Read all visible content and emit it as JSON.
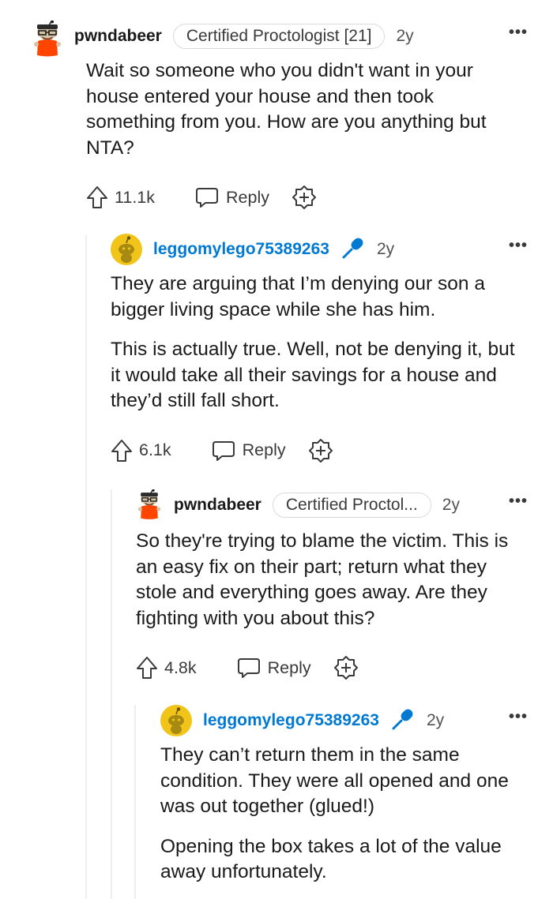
{
  "comments": [
    {
      "username": "pwndabeer",
      "flair": "Certified Proctologist [21]",
      "age": "2y",
      "more": "•••",
      "body": [
        "Wait so someone who you didn't want in your house entered your house and then took something from you. How are you anything but NTA?"
      ],
      "votes": "11.1k",
      "reply_label": "Reply"
    },
    {
      "username": "leggomylego75389263",
      "age": "2y",
      "more": "•••",
      "body": [
        "They are arguing that I’m denying our son a bigger living space while she has him.",
        "This is actually true. Well, not be denying it, but it would take all their savings for a house and they’d still fall short."
      ],
      "votes": "6.1k",
      "reply_label": "Reply"
    },
    {
      "username": "pwndabeer",
      "flair": "Certified Proctol...",
      "age": "2y",
      "more": "•••",
      "body": [
        "So they're trying to blame the victim. This is an easy fix on their part; return what they stole and everything goes away. Are they fighting with you about this?"
      ],
      "votes": "4.8k",
      "reply_label": "Reply"
    },
    {
      "username": "leggomylego75389263",
      "age": "2y",
      "more": "•••",
      "body": [
        "They can’t return them in the same condition. They were all opened and one was out together (glued!)",
        "Opening the box takes a lot of the value away unfortunately."
      ]
    }
  ],
  "colors": {
    "op_username": "#0079d3",
    "mic_icon": "#0079d3",
    "snoo_orange": "#ff4500",
    "snoo_yellow": "#f0c419"
  }
}
